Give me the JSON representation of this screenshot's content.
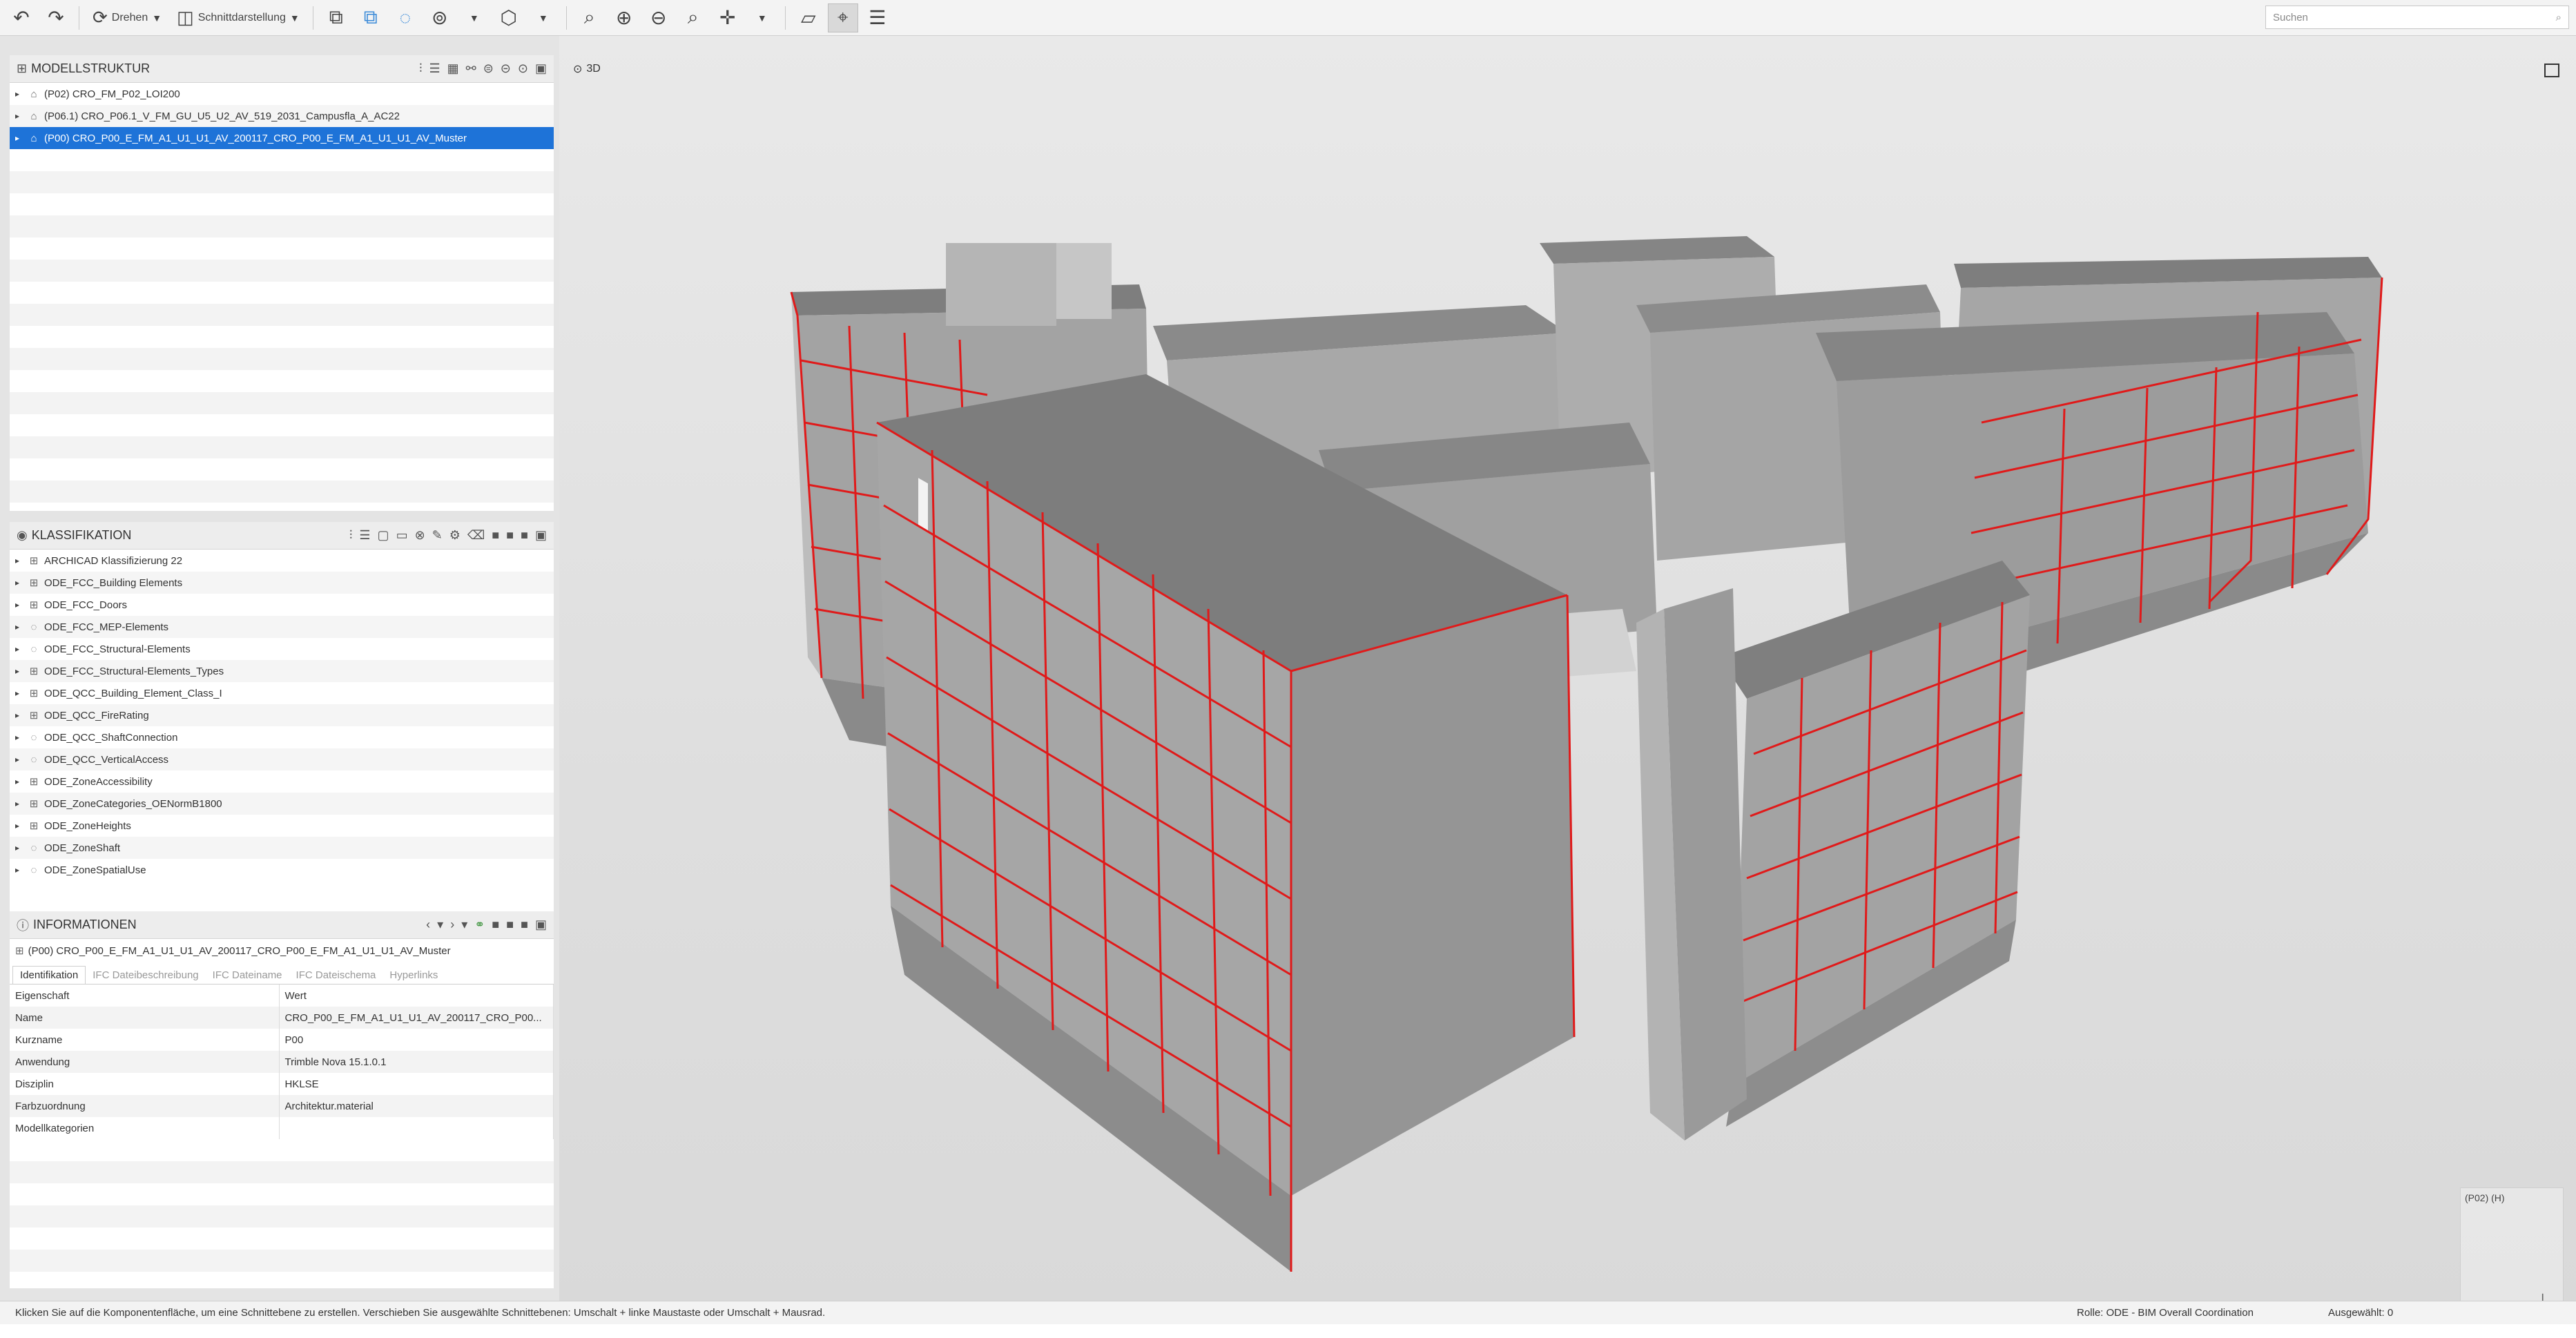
{
  "toolbar": {
    "undo_icon": "undo-icon",
    "redo_icon": "redo-icon",
    "rotate_label": "Drehen",
    "section_label": "Schnittdarstellung",
    "search_placeholder": "Suchen"
  },
  "model_tree": {
    "title": "MODELLSTRUKTUR",
    "items": [
      {
        "label": "(P02) CRO_FM_P02_LOI200",
        "selected": false
      },
      {
        "label": "(P06.1) CRO_P06.1_V_FM_GU_U5_U2_AV_519_2031_Campusfla_A_AC22",
        "selected": false
      },
      {
        "label": "(P00) CRO_P00_E_FM_A1_U1_U1_AV_200117_CRO_P00_E_FM_A1_U1_U1_AV_Muster",
        "selected": true
      }
    ]
  },
  "classification": {
    "title": "KLASSIFIKATION",
    "items": [
      "ARCHICAD Klassifizierung 22",
      "ODE_FCC_Building Elements",
      "ODE_FCC_Doors",
      "ODE_FCC_MEP-Elements",
      "ODE_FCC_Structural-Elements",
      "ODE_FCC_Structural-Elements_Types",
      "ODE_QCC_Building_Element_Class_I",
      "ODE_QCC_FireRating",
      "ODE_QCC_ShaftConnection",
      "ODE_QCC_VerticalAccess",
      "ODE_ZoneAccessibility",
      "ODE_ZoneCategories_OENormB1800",
      "ODE_ZoneHeights",
      "ODE_ZoneShaft",
      "ODE_ZoneSpatialUse"
    ]
  },
  "info": {
    "title": "INFORMATIONEN",
    "path": "(P00) CRO_P00_E_FM_A1_U1_U1_AV_200117_CRO_P00_E_FM_A1_U1_U1_AV_Muster",
    "tabs": [
      "Identifikation",
      "IFC Dateibeschreibung",
      "IFC Dateiname",
      "IFC Dateischema",
      "Hyperlinks"
    ],
    "table": {
      "headers": [
        "Eigenschaft",
        "Wert"
      ],
      "rows": [
        [
          "Name",
          "CRO_P00_E_FM_A1_U1_U1_AV_200117_CRO_P00..."
        ],
        [
          "Kurzname",
          "P00"
        ],
        [
          "Anwendung",
          "Trimble Nova 15.1.0.1"
        ],
        [
          "Disziplin",
          "HKLSE"
        ],
        [
          "Farbzuordnung",
          "Architektur.material"
        ],
        [
          "Modellkategorien",
          ""
        ]
      ]
    }
  },
  "viewport": {
    "label": "3D",
    "navcube_text": "(P02) (H)",
    "colors": {
      "structure": "#9a9a9a",
      "roof": "#808080",
      "outline": "#e01a1a"
    }
  },
  "status": {
    "hint": "Klicken Sie auf die Komponentenfläche, um eine Schnittebene zu erstellen. Verschieben Sie ausgewählte Schnittebenen: Umschalt + linke Maustaste oder Umschalt + Mausrad.",
    "role": "Rolle: ODE - BIM Overall Coordination",
    "selected": "Ausgewählt: 0"
  }
}
